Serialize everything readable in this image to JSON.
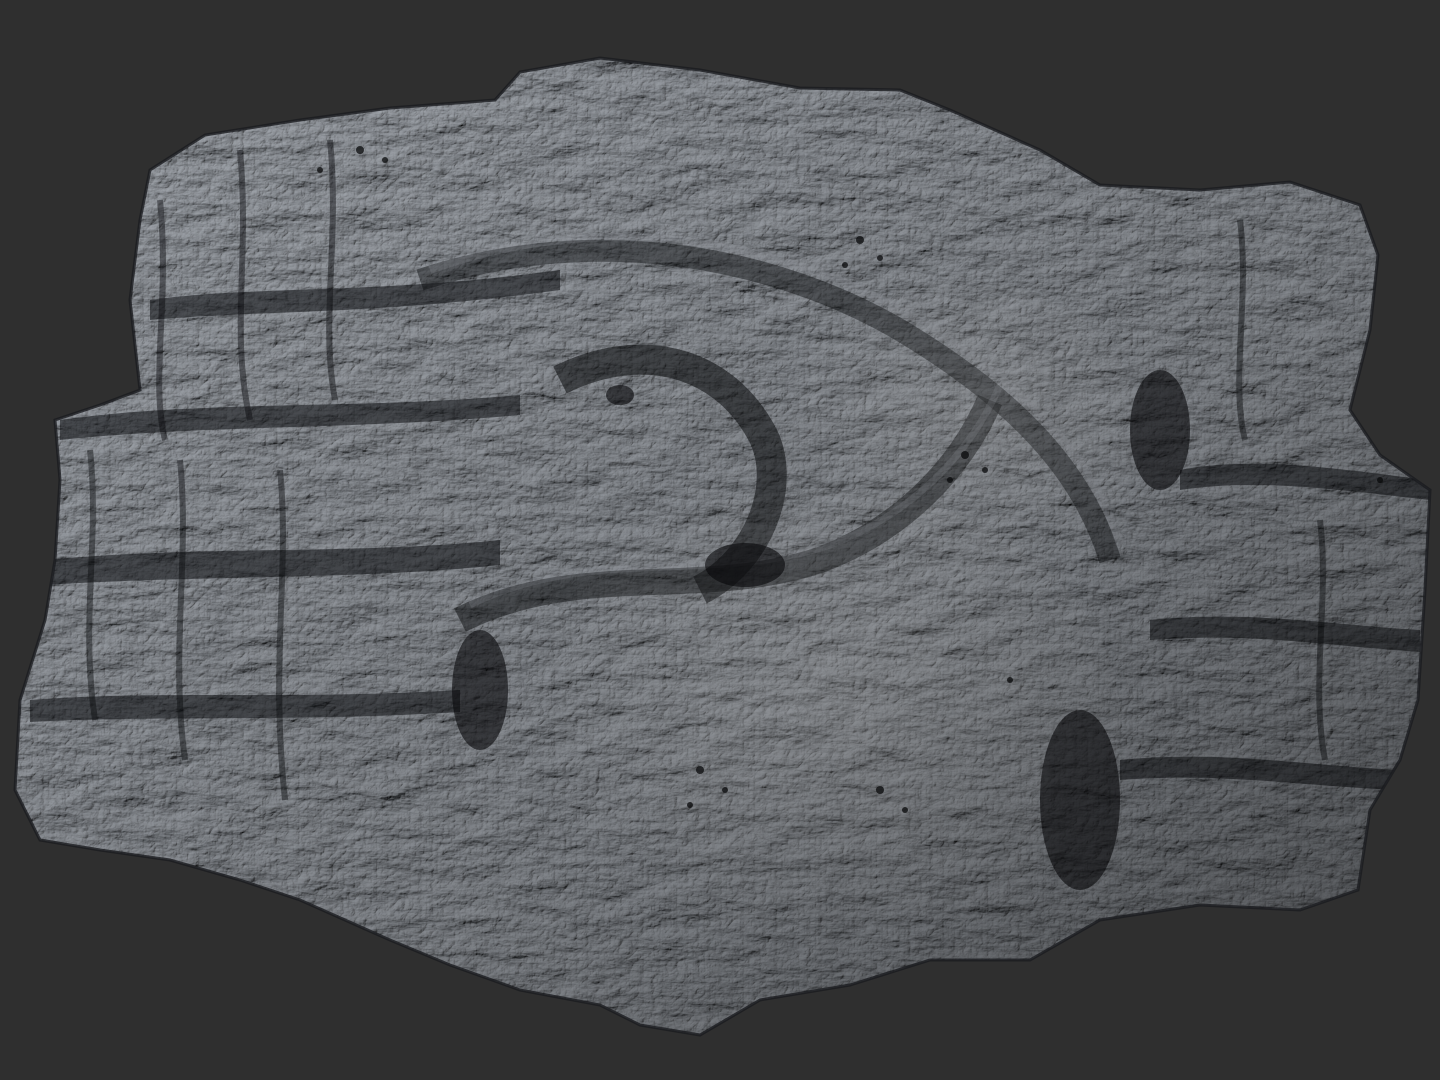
{
  "scene": {
    "subject": "sculpted-rock-formation",
    "colors": {
      "background": "#2f2f2f",
      "rock_dark": "#17191c",
      "rock_mid": "#3c4046",
      "rock_light": "#7d838c",
      "rock_highlight": "#b9bec6"
    }
  }
}
